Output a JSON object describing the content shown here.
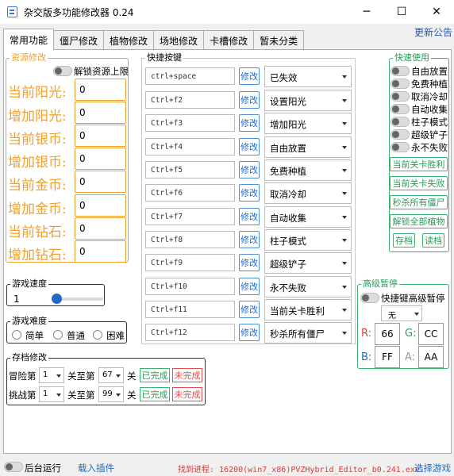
{
  "window": {
    "title": "杂交版多功能修改器  0.24",
    "min_glyph": "─",
    "max_glyph": "☐",
    "close_glyph": "✕"
  },
  "notice": "更新公告",
  "tabs": [
    {
      "label": "常用功能",
      "active": true
    },
    {
      "label": "僵尸修改"
    },
    {
      "label": "植物修改"
    },
    {
      "label": "场地修改"
    },
    {
      "label": "卡槽修改"
    },
    {
      "label": "暂未分类"
    }
  ],
  "resources": {
    "title": "资源修改",
    "unlock_label": "解锁资源上限",
    "rows": [
      {
        "label": "当前阳光:",
        "value": "0"
      },
      {
        "label": "增加阳光:",
        "value": "0"
      },
      {
        "label": "当前银币:",
        "value": "0"
      },
      {
        "label": "增加银币:",
        "value": "0"
      },
      {
        "label": "当前金币:",
        "value": "0"
      },
      {
        "label": "增加金币:",
        "value": "0"
      },
      {
        "label": "当前钻石:",
        "value": "0"
      },
      {
        "label": "增加钻石:",
        "value": "0"
      }
    ]
  },
  "speed": {
    "title": "游戏速度",
    "value": "1"
  },
  "difficulty": {
    "title": "游戏难度",
    "options": [
      "简单",
      "普通",
      "困难"
    ]
  },
  "save": {
    "title": "存档修改",
    "adventure_label": "冒险第",
    "adventure_level": "1",
    "challenge_label": "挑战第",
    "challenge_level": "1",
    "to_label": "关至第",
    "adventure_to": "67",
    "challenge_to": "99",
    "unit": "关",
    "done": "已完成",
    "undone": "未完成"
  },
  "hotkeys": {
    "title": "快捷按键",
    "modify_label": "修改",
    "items": [
      {
        "key": "ctrl+space",
        "action": "已失效"
      },
      {
        "key": "Ctrl+f2",
        "action": "设置阳光"
      },
      {
        "key": "Ctrl+f3",
        "action": "增加阳光"
      },
      {
        "key": "Ctrl+f4",
        "action": "自由放置"
      },
      {
        "key": "Ctrl+f5",
        "action": "免费种植"
      },
      {
        "key": "Ctrl+f6",
        "action": "取消冷却"
      },
      {
        "key": "Ctrl+f7",
        "action": "自动收集"
      },
      {
        "key": "Ctrl+f8",
        "action": "柱子模式"
      },
      {
        "key": "Ctrl+f9",
        "action": "超级铲子"
      },
      {
        "key": "Ctrl+f10",
        "action": "永不失败"
      },
      {
        "key": "Ctrl+f11",
        "action": "当前关卡胜利"
      },
      {
        "key": "Ctrl+f12",
        "action": "秒杀所有僵尸"
      }
    ]
  },
  "quick": {
    "title": "快速使用",
    "toggles": [
      "自由放置",
      "免费种植",
      "取消冷却",
      "自动收集",
      "柱子模式",
      "超级铲子",
      "永不失败"
    ],
    "buttons": [
      "当前关卡胜利",
      "当前关卡失败",
      "秒杀所有僵尸",
      "解锁全部植物"
    ],
    "save_btn": "存档",
    "load_btn": "读档"
  },
  "pause": {
    "title": "高级暂停",
    "toggle_label": "快捷键高级暂停",
    "select_value": "无",
    "r_label": "R:",
    "r_value": "66",
    "g_label": "G:",
    "g_value": "CC",
    "b_label": "B:",
    "b_value": "FF",
    "a_label": "A:",
    "a_value": "AA"
  },
  "footer": {
    "background_label": "后台运行",
    "load_plugin": "载入插件",
    "status": "找到进程: 16200(win7_x86)PVZHybrid_Editor_b0.241.exe",
    "select_game": "选择游戏"
  }
}
